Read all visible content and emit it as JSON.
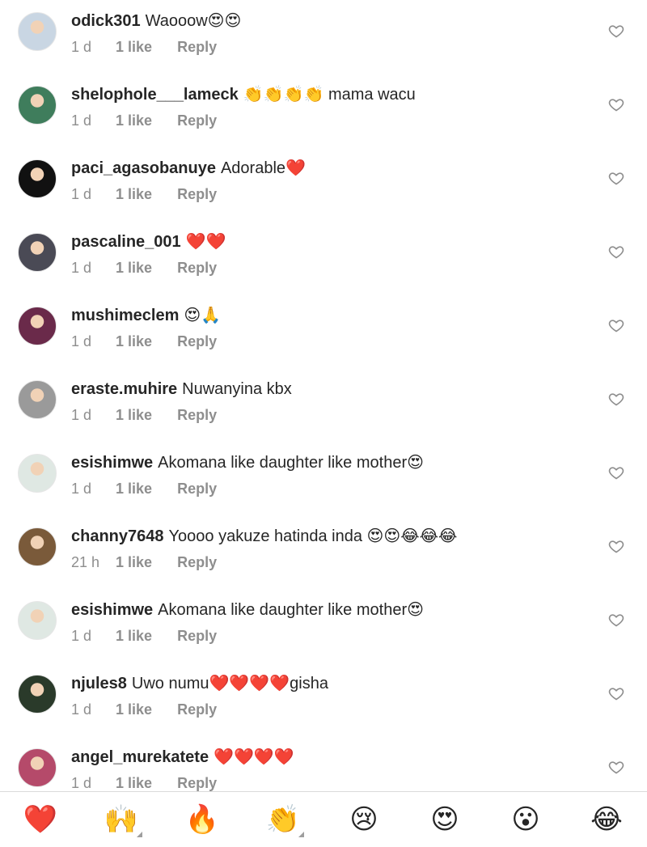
{
  "comments": [
    {
      "username": "odick301",
      "text": "Waooow😍😍",
      "time": "1 d",
      "likes": "1 like",
      "reply": "Reply",
      "avatar_color": "#c9d6e3"
    },
    {
      "username": "shelophole___lameck",
      "text": "👏👏👏👏 mama wacu",
      "time": "1 d",
      "likes": "1 like",
      "reply": "Reply",
      "avatar_color": "#3f7d5c"
    },
    {
      "username": "paci_agasobanuye",
      "text": "Adorable❤️",
      "time": "1 d",
      "likes": "1 like",
      "reply": "Reply",
      "avatar_color": "#111111"
    },
    {
      "username": "pascaline_001",
      "text": "❤️❤️",
      "time": "1 d",
      "likes": "1 like",
      "reply": "Reply",
      "avatar_color": "#4a4a55"
    },
    {
      "username": "mushimeclem",
      "text": "😍🙏",
      "time": "1 d",
      "likes": "1 like",
      "reply": "Reply",
      "avatar_color": "#6a2a4a"
    },
    {
      "username": "eraste.muhire",
      "text": "Nuwanyina kbx",
      "time": "1 d",
      "likes": "1 like",
      "reply": "Reply",
      "avatar_color": "#9a9a9a"
    },
    {
      "username": "esishimwe",
      "text": "Akomana like daughter like mother😍",
      "time": "1 d",
      "likes": "1 like",
      "reply": "Reply",
      "avatar_color": "#dfe8e3"
    },
    {
      "username": "channy7648",
      "text": "Yoooo yakuze hatinda inda 😍😍😂😂😂",
      "time": "21 h",
      "likes": "1 like",
      "reply": "Reply",
      "avatar_color": "#7a5a3a"
    },
    {
      "username": "esishimwe",
      "text": "Akomana like daughter like mother😍",
      "time": "1 d",
      "likes": "1 like",
      "reply": "Reply",
      "avatar_color": "#dfe8e3"
    },
    {
      "username": "njules8",
      "text": "Uwo numu❤️❤️❤️❤️gisha",
      "time": "1 d",
      "likes": "1 like",
      "reply": "Reply",
      "avatar_color": "#2a3a2a"
    },
    {
      "username": "angel_murekatete",
      "text": "❤️❤️❤️❤️",
      "time": "1 d",
      "likes": "1 like",
      "reply": "Reply",
      "avatar_color": "#b54a6a"
    }
  ],
  "reactions": [
    {
      "emoji": "❤️",
      "icon": "red-heart-icon",
      "has_variants": false
    },
    {
      "emoji": "🙌",
      "icon": "raising-hands-icon",
      "has_variants": true
    },
    {
      "emoji": "🔥",
      "icon": "fire-icon",
      "has_variants": false
    },
    {
      "emoji": "👏",
      "icon": "clapping-hands-icon",
      "has_variants": true
    },
    {
      "emoji": "😢",
      "icon": "crying-face-icon",
      "has_variants": false
    },
    {
      "emoji": "😍",
      "icon": "heart-eyes-face-icon",
      "has_variants": false
    },
    {
      "emoji": "😮",
      "icon": "surprised-face-icon",
      "has_variants": false
    },
    {
      "emoji": "😂",
      "icon": "tears-of-joy-face-icon",
      "has_variants": false
    }
  ],
  "colors": {
    "text": "#262626",
    "meta": "#8e8e8e",
    "heart_outline": "#8e8e8e",
    "divider": "#dbdbdb"
  }
}
